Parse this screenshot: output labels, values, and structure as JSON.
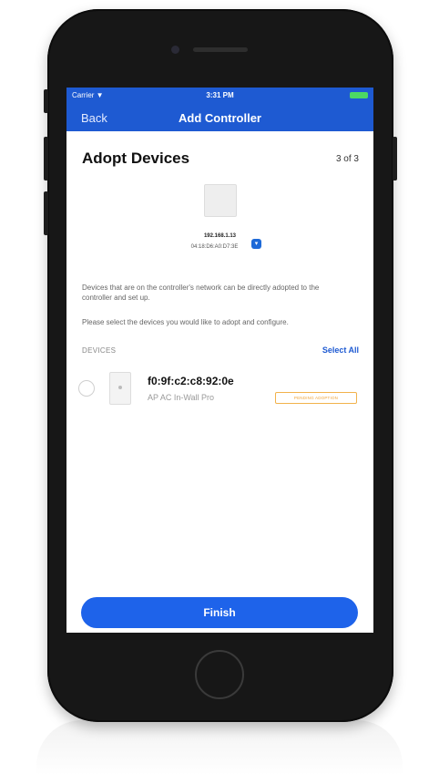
{
  "status_bar": {
    "carrier": "Carrier ▼",
    "time": "3:31 PM"
  },
  "nav": {
    "back_label": "Back",
    "title": "Add Controller"
  },
  "header": {
    "title": "Adopt Devices",
    "step": "3 of 3"
  },
  "controller": {
    "ip": "192.168.1.13",
    "mac": "04:18:D6:A0:D7:3E"
  },
  "description": {
    "line1": "Devices that are on the controller's network can be directly adopted to the controller and set up.",
    "line2": "Please select the devices you would like to adopt and configure."
  },
  "devices_section": {
    "header": "DEVICES",
    "select_all_label": "Select All"
  },
  "device": {
    "mac": "f0:9f:c2:c8:92:0e",
    "model": "AP AC In-Wall Pro",
    "status": "PENDING ADOPTION"
  },
  "actions": {
    "finish_label": "Finish"
  },
  "colors": {
    "accent": "#1e5ad2",
    "button": "#1e63ea",
    "pending": "#f0a43a"
  }
}
